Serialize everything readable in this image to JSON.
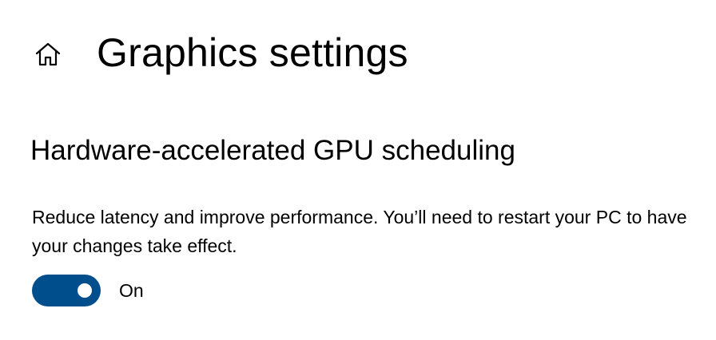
{
  "header": {
    "home_icon": "home-icon",
    "title": "Graphics settings"
  },
  "section": {
    "title": "Hardware-accelerated GPU scheduling",
    "description": "Reduce latency and improve performance. You’ll need to restart your PC to have your changes take effect.",
    "toggle": {
      "state": true,
      "label": "On",
      "accent_color": "#004e8c",
      "knob_color": "#ffffff"
    }
  }
}
